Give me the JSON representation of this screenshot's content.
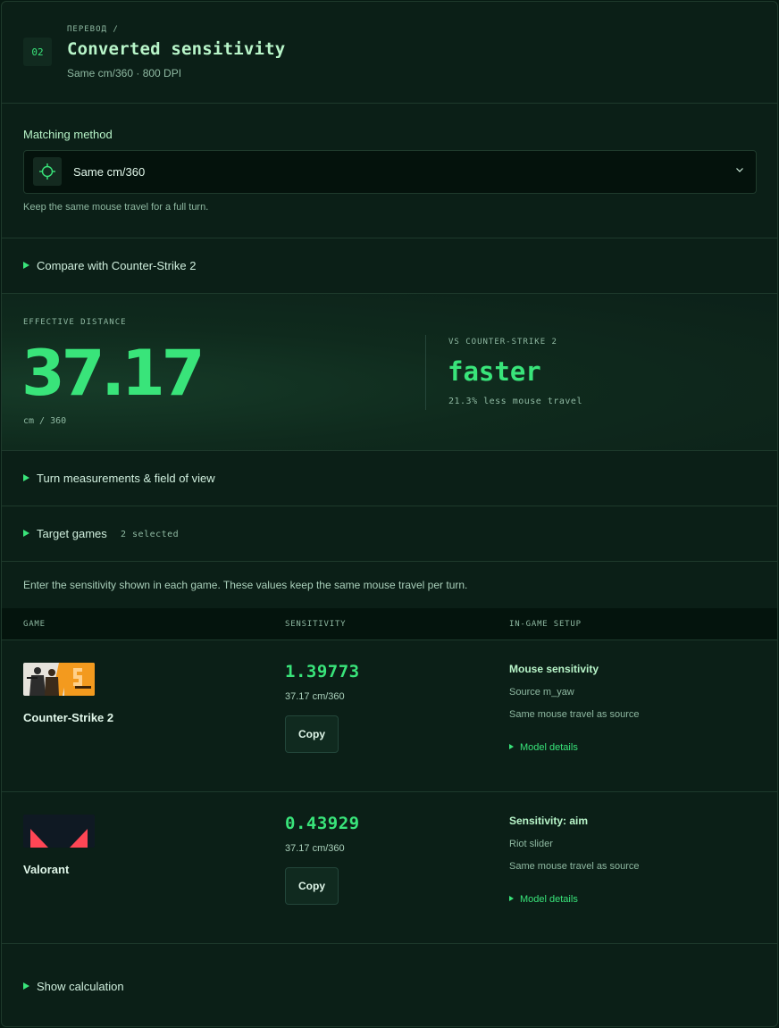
{
  "header": {
    "step": "02",
    "eyebrow": "ПЕРЕВОД /",
    "title": "Converted sensitivity",
    "subtitle": "Same cm/360 · 800 DPI"
  },
  "matching": {
    "label": "Matching method",
    "selected": "Same cm/360",
    "hint": "Keep the same mouse travel for a full turn.",
    "icon": "crosshair-icon"
  },
  "compare": {
    "label": "Compare with Counter-Strike 2"
  },
  "effective": {
    "label": "EFFECTIVE DISTANCE",
    "value": "37.17",
    "unit": "cm / 360",
    "vs_label": "VS COUNTER-STRIKE 2",
    "verdict": "faster",
    "detail": "21.3% less mouse travel"
  },
  "turn": {
    "label": "Turn measurements & field of view"
  },
  "targets": {
    "label": "Target games",
    "count": "2 selected"
  },
  "intro": "Enter the sensitivity shown in each game. These values keep the same mouse travel per turn.",
  "table": {
    "headers": [
      "GAME",
      "SENSITIVITY",
      "IN-GAME SETUP"
    ],
    "rows": [
      {
        "game": "Counter-Strike 2",
        "sensitivity": "1.39773",
        "cm": "37.17 cm/360",
        "copy": "Copy",
        "setup_title": "Mouse sensitivity",
        "setup_l1": "Source m_yaw",
        "setup_l2": "Same mouse travel as source",
        "model": "Model details"
      },
      {
        "game": "Valorant",
        "sensitivity": "0.43929",
        "cm": "37.17 cm/360",
        "copy": "Copy",
        "setup_title": "Sensitivity: aim",
        "setup_l1": "Riot slider",
        "setup_l2": "Same mouse travel as source",
        "model": "Model details"
      }
    ]
  },
  "calculation": {
    "label": "Show calculation"
  },
  "colors": {
    "accent": "#39e47a",
    "background": "#0b1f17",
    "valorant_red": "#ff4655",
    "cs2_orange": "#f39a1e"
  }
}
